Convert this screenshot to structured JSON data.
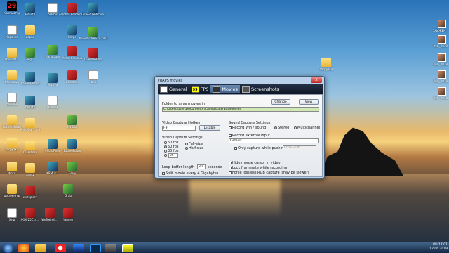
{
  "desktop": {
    "clock_widget": "29",
    "icons_left_col1": [
      "Компьютер",
      "Корзина",
      "PoiskRU...",
      "Shutdown",
      "hackme",
      "RecentPlaces",
      "загрузки",
      "фото",
      "документы",
      "Хэш",
      "ЖЖ-25С14..."
    ],
    "icons_left_col2": [
      "HiSuite",
      "играй",
      "Avg...",
      "Работа Word",
      "CloudX",
      "Рабочий стол",
      "GlassWire",
      "папки",
      "интернет",
      "WeSwimIt..."
    ],
    "icons_left_col3": [
      "5Hsbir",
      "Bandicam",
      "Recuva",
      "Hermes",
      "PhotoFilter",
      "KRMus...",
      "Grab",
      "Yandex"
    ],
    "icons_left_col4": [
      "Acrobat Reader DC",
      "Skype",
      "Avast Cleanup",
      "CCleaner",
      "NVIDIA",
      "ВидеоRoom",
      "Glary",
      "Paint"
    ],
    "icons_left_col5": [
      "FreeZ Webcam",
      "helvetic VHS to DVD",
      "LiveWebCam",
      "Ibidi"
    ],
    "right_icons": [
      "загрузки",
      "ЗАИЖЕН",
      "IMG_2018",
      "IMG_2018",
      "IMG_2018",
      "IMG_2018"
    ]
  },
  "window": {
    "title": "FRAPS movies",
    "close_label": "x",
    "tabs": [
      {
        "label": "General",
        "icon": "monitor-icon"
      },
      {
        "label": "FPS",
        "icon": "fps-icon"
      },
      {
        "label": "Movies",
        "icon": "film-icon"
      },
      {
        "label": "Screenshots",
        "icon": "camera-icon"
      }
    ],
    "folder_label": "Folder to save movies in",
    "folder_value": "C:\\Users\\user\\Documents\\Camtasia\\Fraps\\Movies",
    "change_button": "Change",
    "view_button": "View",
    "hotkey_label": "Video Capture Hotkey",
    "hotkey_value": "F9",
    "disable_button": "Disable",
    "video_settings_label": "Video Capture Settings",
    "fps_options": [
      "60 fps",
      "50 fps",
      "30 fps"
    ],
    "fps_custom_value": "25",
    "size_options": [
      "Full-size",
      "Half-size"
    ],
    "loop_buffer_label": "Loop buffer length",
    "loop_buffer_value": "30",
    "loop_buffer_unit": "seconds",
    "split_label": "Split movie every 4 Gigabytes",
    "sound_settings_label": "Sound Capture Settings",
    "record_win7": "Record Win7 sound",
    "stereo": "Stereo",
    "multichannel": "Multichannel",
    "record_external": "Record external input",
    "external_value": "Default",
    "only_capture": "Only capture while pushing",
    "pushing_hint": "Ctrl+Shift",
    "hide_cursor": "Hide mouse cursor in video",
    "lock_framerate": "Lock framerate while recording",
    "force_lossless": "Force lossless RGB capture (may be slower)"
  },
  "taskbar": {
    "time": "17:01",
    "date": "17.06.2019",
    "lang": "RU"
  }
}
